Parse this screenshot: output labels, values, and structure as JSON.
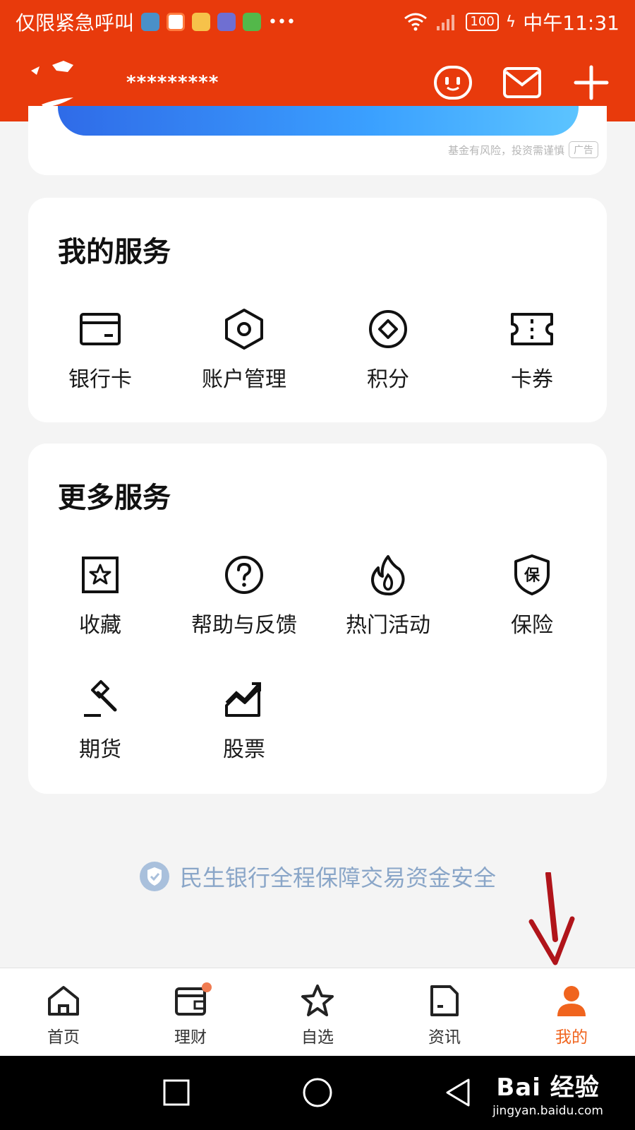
{
  "status_bar": {
    "carrier_text": "仅限紧急呼叫",
    "battery": "100",
    "time": "中午11:31"
  },
  "header": {
    "username": "*********",
    "icons": [
      "chat-bubble-icon",
      "mail-icon",
      "plus-icon"
    ]
  },
  "banner": {
    "disclaimer": "基金有风险，投资需谨慎",
    "ad_tag": "广告"
  },
  "my_services": {
    "title": "我的服务",
    "items": [
      {
        "label": "银行卡",
        "icon": "bank-card-icon"
      },
      {
        "label": "账户管理",
        "icon": "account-hexagon-icon"
      },
      {
        "label": "积分",
        "icon": "points-diamond-icon"
      },
      {
        "label": "卡券",
        "icon": "ticket-icon"
      }
    ]
  },
  "more_services": {
    "title": "更多服务",
    "items": [
      {
        "label": "收藏",
        "icon": "favorite-star-icon"
      },
      {
        "label": "帮助与反馈",
        "icon": "help-icon"
      },
      {
        "label": "热门活动",
        "icon": "fire-icon"
      },
      {
        "label": "保险",
        "icon": "insurance-shield-icon"
      },
      {
        "label": "期货",
        "icon": "gavel-icon"
      },
      {
        "label": "股票",
        "icon": "stock-chart-icon"
      }
    ]
  },
  "security_note": "民生银行全程保障交易资金安全",
  "bottom_nav": {
    "items": [
      {
        "label": "首页",
        "icon": "home-icon",
        "active": false
      },
      {
        "label": "理财",
        "icon": "wallet-icon",
        "active": false,
        "badge_dot": true
      },
      {
        "label": "自选",
        "icon": "star-icon",
        "active": false
      },
      {
        "label": "资讯",
        "icon": "news-icon",
        "active": false
      },
      {
        "label": "我的",
        "icon": "user-icon",
        "active": true
      }
    ]
  },
  "watermark": {
    "main": "Bai 经验",
    "sub": "jingyan.baidu.com"
  },
  "colors": {
    "brand": "#e83a0c",
    "active_tab": "#f0641e",
    "security_text": "#8aa6c8",
    "annotation_arrow": "#b0141a"
  }
}
